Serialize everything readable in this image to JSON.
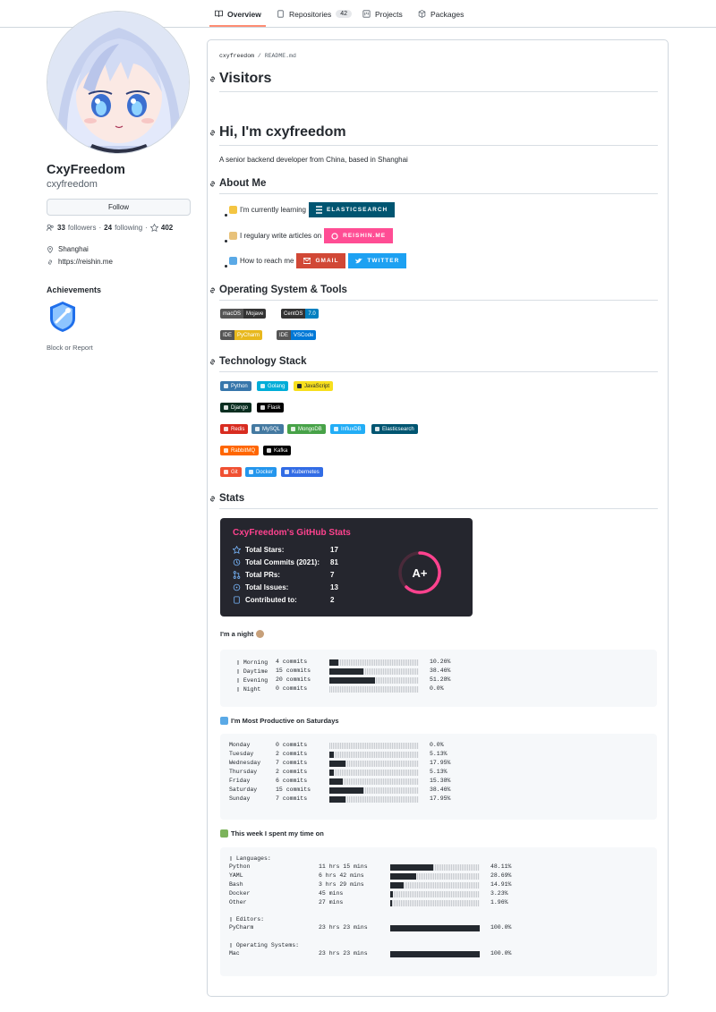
{
  "nav": {
    "tabs": [
      {
        "label": "Overview",
        "icon": "book-icon"
      },
      {
        "label": "Repositories",
        "icon": "repo-icon",
        "count": "42"
      },
      {
        "label": "Projects",
        "icon": "project-icon"
      },
      {
        "label": "Packages",
        "icon": "package-icon"
      }
    ]
  },
  "profile": {
    "name": "CxyFreedom",
    "login": "cxyfreedom",
    "follow_label": "Follow",
    "followers_count": "33",
    "followers_label": "followers",
    "following_count": "24",
    "following_label": "following",
    "stars_count": "402",
    "location": "Shanghai",
    "website": "https://reishin.me",
    "achievements_title": "Achievements",
    "block_report": "Block or Report"
  },
  "readme": {
    "crumb_user": "cxyfreedom",
    "crumb_sep": "/",
    "crumb_file": "README.md",
    "h_visitors": "Visitors",
    "h_hi": "Hi, I'm cxyfreedom",
    "intro": "A senior backend developer from China, based in Shanghai",
    "h_about": "About Me",
    "about_items": [
      {
        "text": "I'm currently learning",
        "badge": "ELASTICSEARCH",
        "color": "#005571"
      },
      {
        "text": "I regulary write articles on",
        "badge": "REISHIN.ME",
        "color": "#ff4d94"
      },
      {
        "text": "How to reach me",
        "badge": "GMAIL",
        "color": "#d14836",
        "badge2": "TWITTER",
        "color2": "#1da1f2"
      }
    ],
    "h_os": "Operating System & Tools",
    "os_badges": [
      {
        "left": "macOS",
        "right": "Mojave",
        "lc": "#555555",
        "rc": "#333333"
      },
      {
        "left": "CentOS",
        "right": "7.0",
        "lc": "#333333",
        "rc": "#0080c0"
      },
      {
        "left": "IDE",
        "right": "PyCharm",
        "lc": "#555555",
        "rc": "#e8b81d"
      },
      {
        "left": "IDE",
        "right": "VSCode",
        "lc": "#555555",
        "rc": "#0078d7"
      }
    ],
    "h_tech": "Technology Stack",
    "tech_rows": [
      [
        {
          "label": "Python",
          "color": "#3776ab"
        },
        {
          "label": "Golang",
          "color": "#00add8"
        },
        {
          "label": "JavaScript",
          "color": "#f7df1e",
          "dark": true
        }
      ],
      [
        {
          "label": "Django",
          "color": "#092e20"
        },
        {
          "label": "Flask",
          "color": "#000000"
        }
      ],
      [
        {
          "label": "Redis",
          "color": "#d82c20"
        },
        {
          "label": "MySQL",
          "color": "#4479a1"
        },
        {
          "label": "MongoDB",
          "color": "#47a248"
        },
        {
          "label": "InfluxDB",
          "color": "#22adf6"
        },
        {
          "label": "Elasticsearch",
          "color": "#005571"
        }
      ],
      [
        {
          "label": "RabbitMQ",
          "color": "#ff6600"
        },
        {
          "label": "Kafka",
          "color": "#000000"
        }
      ],
      [
        {
          "label": "Git",
          "color": "#f05032"
        },
        {
          "label": "Docker",
          "color": "#2496ed"
        },
        {
          "label": "Kubernetes",
          "color": "#326ce5"
        }
      ]
    ],
    "h_stats": "Stats"
  },
  "stats_card": {
    "title": "CxyFreedom's GitHub Stats",
    "rows": [
      {
        "label": "Total Stars:",
        "value": "17"
      },
      {
        "label": "Total Commits (2021):",
        "value": "81"
      },
      {
        "label": "Total PRs:",
        "value": "7"
      },
      {
        "label": "Total Issues:",
        "value": "13"
      },
      {
        "label": "Contributed to:",
        "value": "2"
      }
    ],
    "grade": "A+",
    "accent": "#fe428e",
    "background": "#25262e"
  },
  "night": {
    "title": "I'm a night",
    "rows": [
      {
        "label": "Morning",
        "commits": "4 commits",
        "pct": "10.26%",
        "frac": 0.1026
      },
      {
        "label": "Daytime",
        "commits": "15 commits",
        "pct": "38.46%",
        "frac": 0.3846
      },
      {
        "label": "Evening",
        "commits": "20 commits",
        "pct": "51.28%",
        "frac": 0.5128
      },
      {
        "label": "Night",
        "commits": "0 commits",
        "pct": "0.0%",
        "frac": 0
      }
    ]
  },
  "weekdays": {
    "title": "I'm Most Productive on Saturdays",
    "rows": [
      {
        "label": "Monday",
        "commits": "0 commits",
        "pct": "0.0%",
        "frac": 0
      },
      {
        "label": "Tuesday",
        "commits": "2 commits",
        "pct": "5.13%",
        "frac": 0.0513
      },
      {
        "label": "Wednesday",
        "commits": "7 commits",
        "pct": "17.95%",
        "frac": 0.1795
      },
      {
        "label": "Thursday",
        "commits": "2 commits",
        "pct": "5.13%",
        "frac": 0.0513
      },
      {
        "label": "Friday",
        "commits": "6 commits",
        "pct": "15.38%",
        "frac": 0.1538
      },
      {
        "label": "Saturday",
        "commits": "15 commits",
        "pct": "38.46%",
        "frac": 0.3846
      },
      {
        "label": "Sunday",
        "commits": "7 commits",
        "pct": "17.95%",
        "frac": 0.1795
      }
    ]
  },
  "week": {
    "title": "This week I spent my time on",
    "languages_label": "Languages:",
    "languages": [
      {
        "label": "Python",
        "time": "11 hrs 15 mins",
        "pct": "48.11%",
        "frac": 0.4811
      },
      {
        "label": "YAML",
        "time": "6 hrs 42 mins",
        "pct": "28.69%",
        "frac": 0.2869
      },
      {
        "label": "Bash",
        "time": "3 hrs 29 mins",
        "pct": "14.91%",
        "frac": 0.1491
      },
      {
        "label": "Docker",
        "time": "45 mins",
        "pct": "3.23%",
        "frac": 0.0323
      },
      {
        "label": "Other",
        "time": "27 mins",
        "pct": "1.96%",
        "frac": 0.0196
      }
    ],
    "editors_label": "Editors:",
    "editors": [
      {
        "label": "PyCharm",
        "time": "23 hrs 23 mins",
        "pct": "100.0%",
        "frac": 1.0
      }
    ],
    "os_label": "Operating Systems:",
    "os": [
      {
        "label": "Mac",
        "time": "23 hrs 23 mins",
        "pct": "100.0%",
        "frac": 1.0
      }
    ]
  }
}
